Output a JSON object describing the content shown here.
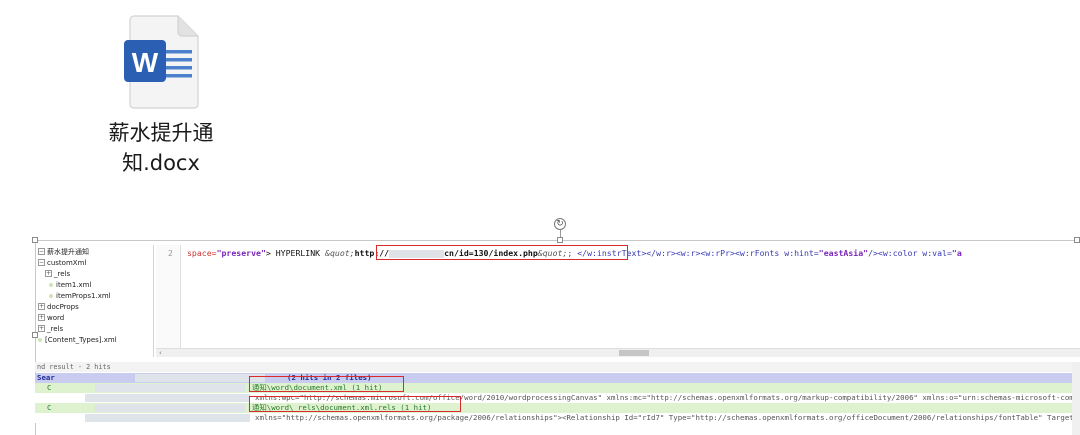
{
  "desktop_file": {
    "icon": "word-document-icon",
    "icon_letter": "W",
    "brand_color": "#2b5fb4",
    "name_line1": "薪水提升通",
    "name_line2": "知.docx"
  },
  "tree": {
    "items": [
      {
        "label": "薪水提升通知"
      },
      {
        "label": "customXml"
      },
      {
        "label": "_rels"
      },
      {
        "label": "item1.xml"
      },
      {
        "label": "itemProps1.xml"
      },
      {
        "label": "docProps"
      },
      {
        "label": "word"
      },
      {
        "label": "_rels"
      },
      {
        "label": "[Content_Types].xml"
      }
    ]
  },
  "editor": {
    "line_number": "2",
    "seg_space_attr": "space=",
    "seg_space_val": "\"preserve\"",
    "seg_hyperlink": "> HYPERLINK ",
    "seg_quot": "&quot;",
    "seg_url_start": "http://",
    "seg_url_end": "cn/id=130/index.php",
    "seg_quot2": "&quot;",
    "seg_rest1": "; </w:instrText></w:r><w:r><w:rPr><w:rFonts w:hint=",
    "seg_east": "\"eastAsia\"",
    "seg_rest2": "/><w:color w:val=",
    "seg_tail": "\"a"
  },
  "find": {
    "title": "nd result - 2 hits",
    "search_prefix": "Sear",
    "search_suffix": "(2 hits in 2 files)",
    "file1": "通知\\word\\document.xml (1 hit)",
    "hit1": "xmlns:wpc=\"http://schemas.microsoft.com/office/word/2010/wordprocessingCanvas\" xmlns:mc=\"http://schemas.openxmlformats.org/markup-compatibility/2006\" xmlns:o=\"urn:schemas-microsoft-com:office",
    "file2": "通知\\word\\_rels\\document.xml.rels (1 hit)",
    "hit2": "xmlns=\"http://schemas.openxmlformats.org/package/2006/relationships\"><Relationship Id=\"rId7\" Type=\"http://schemas.openxmlformats.org/officeDocument/2006/relationships/fontTable\" Target=\"fo"
  }
}
